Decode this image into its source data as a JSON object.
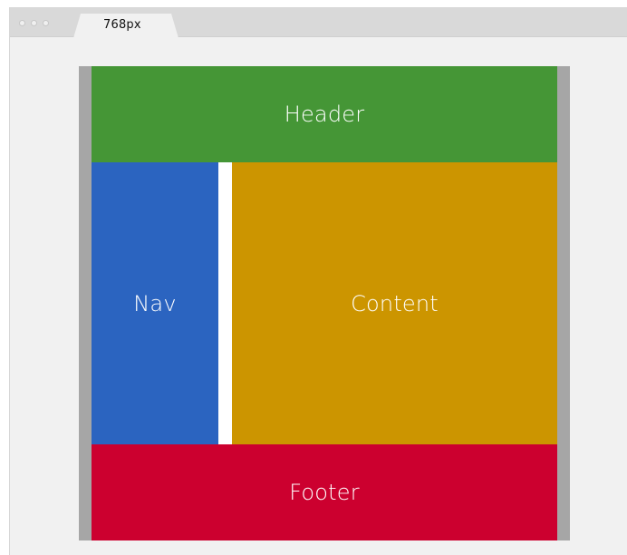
{
  "browser": {
    "tab_label": "768px"
  },
  "layout": {
    "header_label": "Header",
    "nav_label": "Nav",
    "content_label": "Content",
    "footer_label": "Footer"
  },
  "colors": {
    "header": "#459636",
    "nav": "#2b64c0",
    "content": "#cc9500",
    "footer": "#cc002f",
    "viewport_margin": "#a6a6a6",
    "browser_bg": "#f1f1f1"
  }
}
